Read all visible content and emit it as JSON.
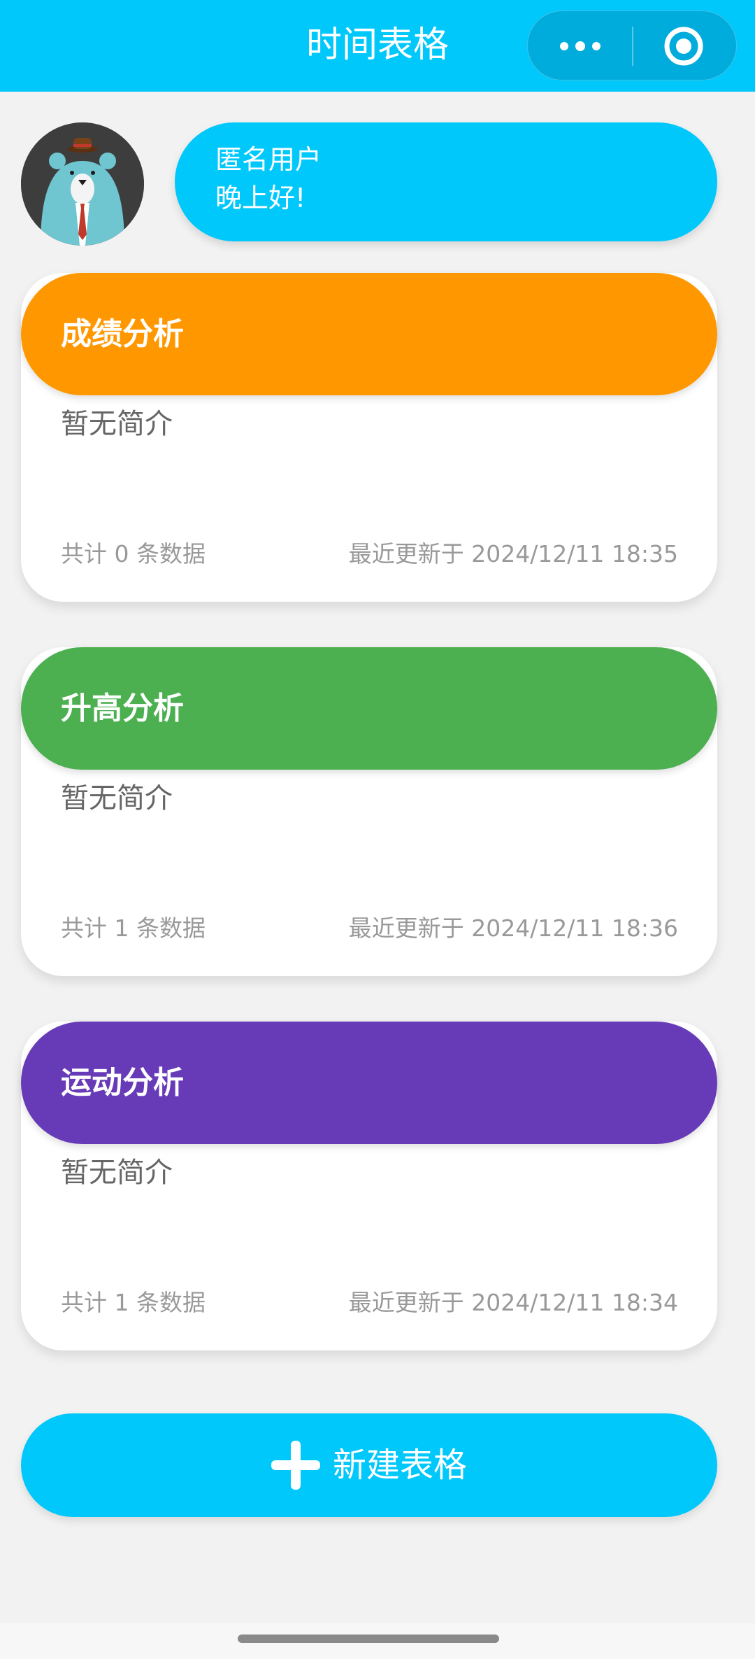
{
  "header": {
    "title": "时间表格",
    "background_color": "#00c8fb"
  },
  "capsule": {
    "more_icon": "more-dots-icon",
    "close_icon": "target-circle-icon"
  },
  "user": {
    "avatar_icon": "bear-avatar-icon",
    "name": "匿名用户",
    "greeting": "晚上好!"
  },
  "cards": [
    {
      "title": "成绩分析",
      "color": "#ff9800",
      "description": "暂无简介",
      "count_text": "共计 0 条数据",
      "updated_text": "最近更新于 2024/12/11 18:35"
    },
    {
      "title": "升高分析",
      "color": "#4caf50",
      "description": "暂无简介",
      "count_text": "共计 1 条数据",
      "updated_text": "最近更新于 2024/12/11 18:36"
    },
    {
      "title": "运动分析",
      "color": "#673ab7",
      "description": "暂无简介",
      "count_text": "共计 1 条数据",
      "updated_text": "最近更新于 2024/12/11 18:34"
    }
  ],
  "new_button": {
    "icon": "plus-icon",
    "label": "新建表格"
  }
}
